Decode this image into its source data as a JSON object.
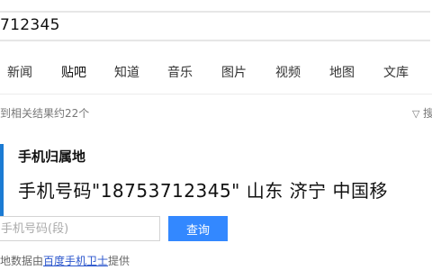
{
  "search": {
    "value": "712345"
  },
  "nav": {
    "items": [
      {
        "label": "新闻"
      },
      {
        "label": "贴吧"
      },
      {
        "label": "知道"
      },
      {
        "label": "音乐"
      },
      {
        "label": "图片"
      },
      {
        "label": "视频"
      },
      {
        "label": "地图"
      },
      {
        "label": "文库"
      }
    ],
    "active_index": 1
  },
  "results": {
    "count_text": "到相关结果约22个",
    "filter_icon": "funnel-icon",
    "filter_label": "搜"
  },
  "card": {
    "title": "手机归属地",
    "headline": "手机号码\"18753712345\" 山东 济宁  中国移",
    "input_placeholder": "手机号码(段)",
    "query_button": "查询",
    "source_prefix": "地数据由",
    "source_link": "百度手机卫士",
    "source_suffix": "提供"
  },
  "colors": {
    "accent": "#1b7bd3",
    "button": "#3388ff",
    "link": "#2a55cc"
  }
}
